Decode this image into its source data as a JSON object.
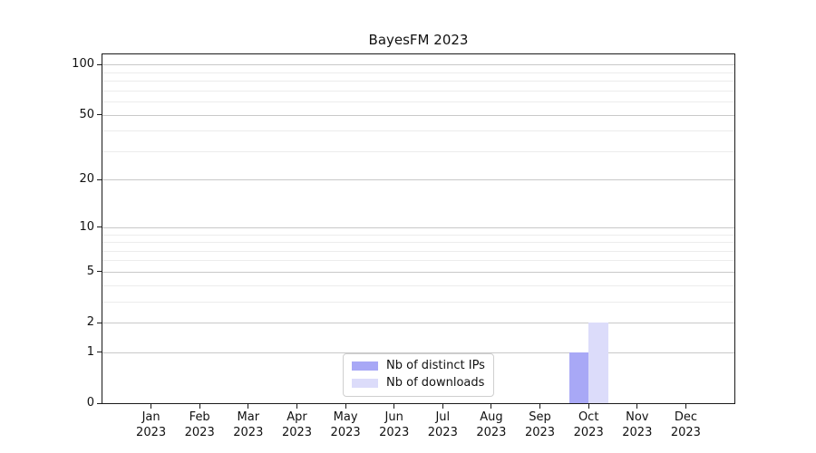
{
  "title": "BayesFM 2023",
  "chart_data": {
    "type": "bar",
    "title": "BayesFM 2023",
    "xlabel": "",
    "ylabel": "",
    "categories": [
      "Jan",
      "Feb",
      "Mar",
      "Apr",
      "May",
      "Jun",
      "Jul",
      "Aug",
      "Sep",
      "Oct",
      "Nov",
      "Dec"
    ],
    "category_year_label": "2023",
    "series": [
      {
        "name": "Nb of distinct IPs",
        "color": "#a8a8f6",
        "values": [
          0,
          0,
          0,
          0,
          0,
          0,
          0,
          0,
          0,
          1,
          0,
          0
        ]
      },
      {
        "name": "Nb of downloads",
        "color": "#dcdcfa",
        "values": [
          0,
          0,
          0,
          0,
          0,
          0,
          0,
          0,
          0,
          2,
          0,
          0
        ]
      }
    ],
    "yscale": "log1p",
    "ylim": [
      0,
      115
    ],
    "y_major_ticks": [
      0,
      1,
      2,
      5,
      10,
      20,
      50,
      100
    ],
    "y_minor_gridlines": [
      3,
      4,
      6,
      7,
      8,
      9,
      30,
      40,
      60,
      70,
      80,
      90
    ],
    "grid": "horizontal",
    "legend_position": "lower center"
  },
  "colors": {
    "background": "#ffffff",
    "axis": "#1a1a1a",
    "text": "#111111",
    "major_grid": "#c9c9c9",
    "minor_grid": "#ececec",
    "legend_border": "#cfcfcf",
    "bar_distinct_ips": "#a8a8f6",
    "bar_downloads": "#dcdcfa"
  }
}
